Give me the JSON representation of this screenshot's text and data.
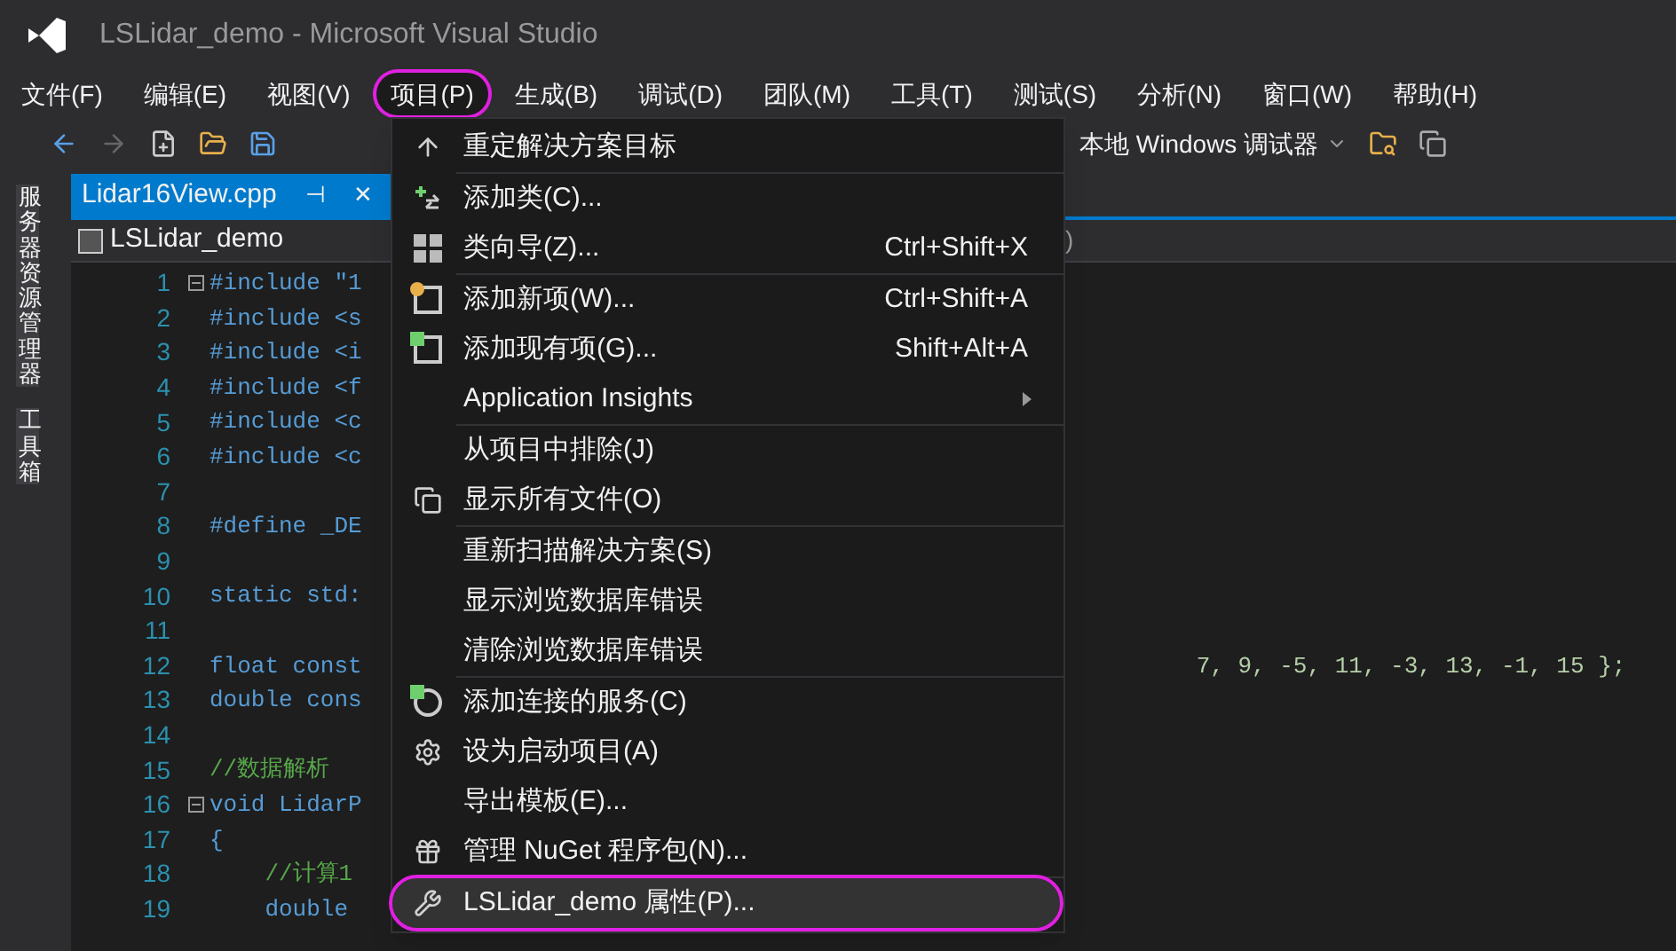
{
  "window": {
    "title": "LSLidar_demo - Microsoft Visual Studio"
  },
  "menu_bar": [
    {
      "label": "文件(F)",
      "selected": false
    },
    {
      "label": "编辑(E)",
      "selected": false
    },
    {
      "label": "视图(V)",
      "selected": false
    },
    {
      "label": "项目(P)",
      "selected": true
    },
    {
      "label": "生成(B)",
      "selected": false
    },
    {
      "label": "调试(D)",
      "selected": false
    },
    {
      "label": "团队(M)",
      "selected": false
    },
    {
      "label": "工具(T)",
      "selected": false
    },
    {
      "label": "测试(S)",
      "selected": false
    },
    {
      "label": "分析(N)",
      "selected": false
    },
    {
      "label": "窗口(W)",
      "selected": false
    },
    {
      "label": "帮助(H)",
      "selected": false
    }
  ],
  "toolbar": {
    "debugger": "本地 Windows 调试器"
  },
  "side_tabs": [
    "服务器资源管理器",
    "工具箱"
  ],
  "editor_tab": {
    "label": "Lidar16View.cpp",
    "pin": "⊣",
    "close": "✕"
  },
  "nav_bar": {
    "project": "LSLidar_demo",
    "right": ")"
  },
  "code_lines": [
    {
      "num": "1",
      "text": "#include \"1",
      "fold": true
    },
    {
      "num": "2",
      "text": "#include <s"
    },
    {
      "num": "3",
      "text": "#include <i"
    },
    {
      "num": "4",
      "text": "#include <f"
    },
    {
      "num": "5",
      "text": "#include <c"
    },
    {
      "num": "6",
      "text": "#include <c"
    },
    {
      "num": "7"
    },
    {
      "num": "8",
      "text": "#define _DE"
    },
    {
      "num": "9"
    },
    {
      "num": "10",
      "text": "static std:"
    },
    {
      "num": "11"
    },
    {
      "num": "12",
      "text": "float const",
      "tail": "7, 9, -5, 11, -3, 13, -1, 15 };"
    },
    {
      "num": "13",
      "text": "double cons"
    },
    {
      "num": "14"
    },
    {
      "num": "15",
      "text": "//数据解析",
      "comment": true
    },
    {
      "num": "16",
      "text": "void LidarP",
      "fold": true
    },
    {
      "num": "17",
      "text": "{"
    },
    {
      "num": "18",
      "text": "    //计算1",
      "comment": true
    },
    {
      "num": "19",
      "text": "    double"
    }
  ],
  "project_menu": [
    [
      {
        "label": "重定解决方案目标",
        "selected": false
      }
    ],
    [
      {
        "label": "添加类(C)...",
        "selected": false
      },
      {
        "label": "类向导(Z)...",
        "shortcut": "Ctrl+Shift+X",
        "selected": false
      }
    ],
    [
      {
        "label": "添加新项(W)...",
        "shortcut": "Ctrl+Shift+A",
        "selected": false
      },
      {
        "label": "添加现有项(G)...",
        "shortcut": "Shift+Alt+A",
        "selected": false
      },
      {
        "label": "Application Insights",
        "submenu": true,
        "selected": false
      }
    ],
    [
      {
        "label": "从项目中排除(J)",
        "selected": false
      },
      {
        "label": "显示所有文件(O)",
        "selected": false
      }
    ],
    [
      {
        "label": "重新扫描解决方案(S)",
        "selected": false
      },
      {
        "label": "显示浏览数据库错误",
        "selected": false
      },
      {
        "label": "清除浏览数据库错误",
        "selected": false
      }
    ],
    [
      {
        "label": "添加连接的服务(C)",
        "selected": false
      },
      {
        "label": "设为启动项目(A)",
        "selected": false
      },
      {
        "label": "导出模板(E)...",
        "selected": false
      },
      {
        "label": "管理 NuGet 程序包(N)...",
        "selected": false
      }
    ],
    [
      {
        "label": "LSLidar_demo 属性(P)...",
        "selected": true
      }
    ]
  ]
}
